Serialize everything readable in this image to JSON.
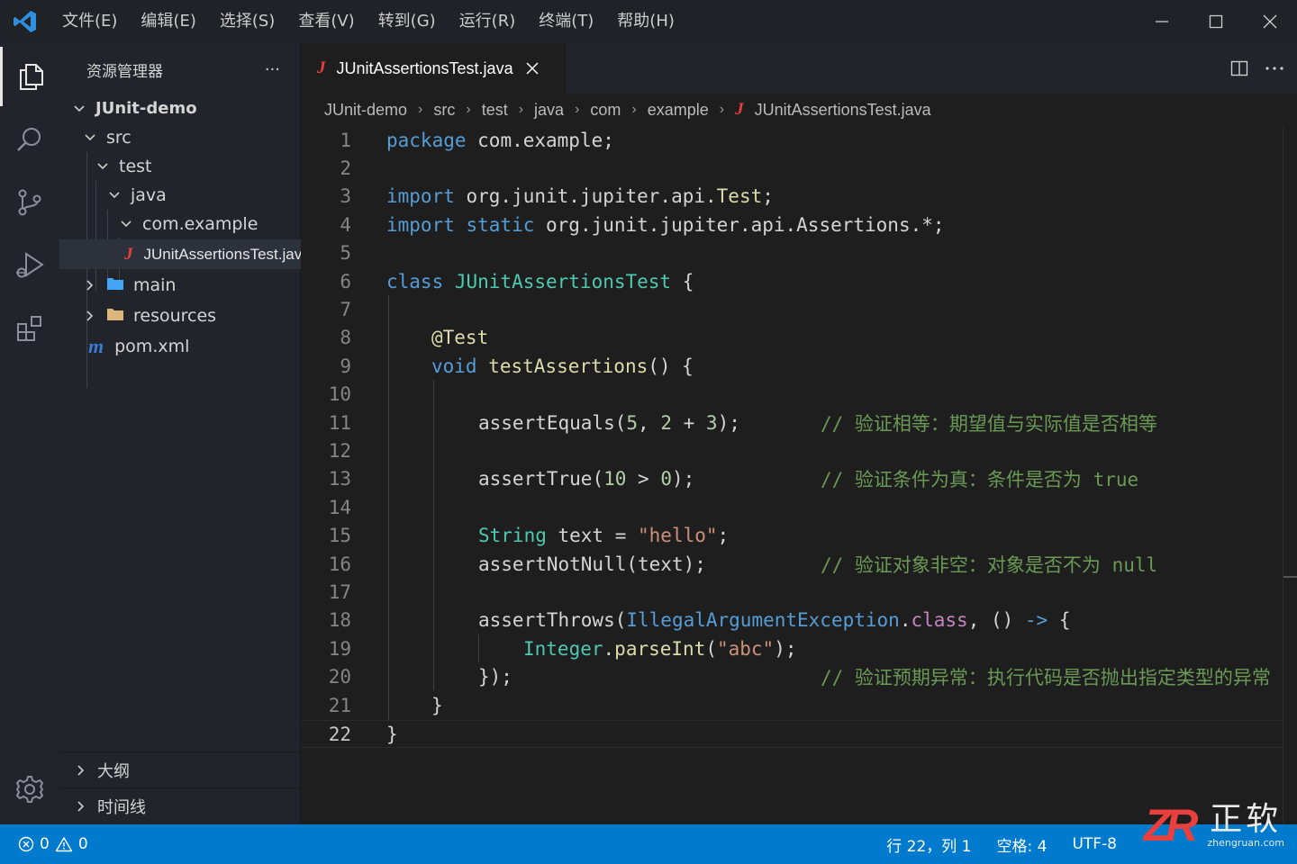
{
  "menu": [
    "文件(E)",
    "编辑(E)",
    "选择(S)",
    "查看(V)",
    "转到(G)",
    "运行(R)",
    "终端(T)",
    "帮助(H)"
  ],
  "sidebar": {
    "title": "资源管理器",
    "more": "···",
    "tree": {
      "root": "JUnit-demo",
      "src": "src",
      "test": "test",
      "java": "java",
      "package": "com.example",
      "file": "JUnitAssertionsTest.java",
      "main": "main",
      "resources": "resources",
      "pom_icon": "m",
      "pom": "pom.xml"
    },
    "outline": "大纲",
    "timeline": "时间线"
  },
  "tab": {
    "icon": "J",
    "label": "JUnitAssertionsTest.java"
  },
  "breadcrumb": [
    "JUnit-demo",
    "src",
    "test",
    "java",
    "com",
    "example",
    "JUnitAssertionsTest.java"
  ],
  "breadcrumb_sep": "›",
  "editor": {
    "line_numbers": [
      "1",
      "2",
      "3",
      "4",
      "5",
      "6",
      "7",
      "8",
      "9",
      "10",
      "11",
      "12",
      "13",
      "14",
      "15",
      "16",
      "17",
      "18",
      "19",
      "20",
      "21",
      "22"
    ],
    "code": {
      "l1_kw": "package",
      "l1_rest": " com.example;",
      "l3_kw": "import",
      "l3_pkg": " org.junit.jupiter.api.",
      "l3_cls": "Test",
      "l3_end": ";",
      "l4_kw": "import",
      "l4_kw2": " static",
      "l4_rest": " org.junit.jupiter.api.Assertions.*;",
      "l6_kw": "class",
      "l6_cls": " JUnitAssertionsTest",
      "l6_end": " {",
      "l8_ann": "@Test",
      "l9_kw": "void",
      "l9_fn": " testAssertions",
      "l9_end": "() {",
      "l11_fn": "assertEquals",
      "l11_a": "(",
      "l11_n1": "5",
      "l11_b": ", ",
      "l11_n2": "2",
      "l11_c": " + ",
      "l11_n3": "3",
      "l11_d": ");",
      "l11_cmt": "// 验证相等：期望值与实际值是否相等",
      "l13_fn": "assertTrue",
      "l13_a": "(",
      "l13_n1": "10",
      "l13_b": " > ",
      "l13_n2": "0",
      "l13_c": ");",
      "l13_cmt": "// 验证条件为真：条件是否为 true",
      "l15_ty": "String",
      "l15_var": " text",
      "l15_eq": " = ",
      "l15_str": "\"hello\"",
      "l15_end": ";",
      "l16_fn": "assertNotNull",
      "l16_rest": "(text);",
      "l16_cmt": "// 验证对象非空：对象是否不为 null",
      "l18_fn": "assertThrows",
      "l18_a": "(",
      "l18_ty": "IllegalArgumentException",
      "l18_dot": ".",
      "l18_kw": "class",
      "l18_b": ", () ",
      "l18_arrow": "->",
      "l18_c": " {",
      "l19_ty": "Integer",
      "l19_dot": ".",
      "l19_fn": "parseInt",
      "l19_a": "(",
      "l19_str": "\"abc\"",
      "l19_b": ");",
      "l20": "});",
      "l20_cmt": "// 验证预期异常：执行代码是否抛出指定类型的异常",
      "l21": "}",
      "l22": "}"
    }
  },
  "status": {
    "errors": "0",
    "warnings": "0",
    "position": "行 22，列 1",
    "spaces": "空格: 4",
    "encoding": "UTF-8"
  },
  "watermark": {
    "logo": "ZR",
    "brand": "正软",
    "url": "zhengruan.com"
  },
  "colors": {
    "statusbar": "#007acc",
    "java_icon": "#e9403e",
    "folder": "#dcb67a",
    "folder_blue": "#42a5f5",
    "pom_icon": "#3a7bd5"
  }
}
